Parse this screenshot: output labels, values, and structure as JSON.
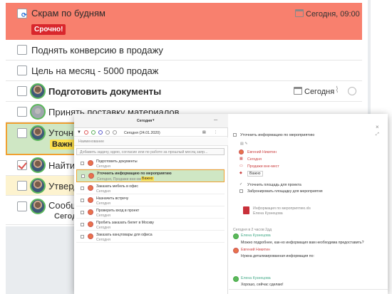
{
  "tasks": [
    {
      "title": "Скрам по будням",
      "badge": "Срочно!",
      "date": "Сегодня, 09:00"
    },
    {
      "title": "Поднять конверсию в продажу"
    },
    {
      "title": "Цель на месяц - 5000 продаж"
    },
    {
      "title": "Подготовить документы",
      "date": "Сегодня"
    },
    {
      "title": "Принять поставку материалов"
    },
    {
      "title": "Уточнить информацию по мероприятию",
      "title_visible": "Уточни",
      "badge": "Важно",
      "badge_visible": "Важн"
    },
    {
      "title_visible": "Найти"
    },
    {
      "title_visible": "Утверд"
    },
    {
      "title_visible": "Сообщ",
      "date_visible": "Сегодн"
    }
  ],
  "window": {
    "left": {
      "period": "Сегодня",
      "date_filter": "Сегодня (24.01.2020)",
      "column_header": "Наименование",
      "search_placeholder": "Добавить задачу, идею, согласие или по работе за прошлый месяц запр...",
      "items": [
        {
          "title": "Подготовить документы",
          "sub": "Сегодня"
        },
        {
          "title": "Уточнить информацию по мероприятию",
          "sub": "Сегодня, Продажи вне-мест",
          "badge": "Важно"
        },
        {
          "title": "Заказать мебель в офис",
          "sub": "Сегодня"
        },
        {
          "title": "Назначить встречу",
          "sub": "Сегодня"
        },
        {
          "title": "Проверить вход в проект",
          "sub": "Сегодня"
        },
        {
          "title": "Пробить заказать билет в Москву",
          "sub": "Сегодня"
        },
        {
          "title": "Заказать канцтовары для офиса",
          "sub": "Сегодня"
        }
      ]
    },
    "right": {
      "task_title": "Уточнить информацию по мероприятию",
      "fields": [
        "Евгений Никитин",
        "Сегодня",
        "Продажи вне-мест",
        "Важно"
      ],
      "subtasks": [
        "Уточнить площадь для проекта",
        "Забронировать площадку для мероприятия"
      ],
      "attachment": "Информация по мероприятию.xls",
      "attachment_sub": "Елена Кузнецова",
      "comments_header": "Сегодня в 2 часов 2дд",
      "comments": [
        {
          "author": "Елена Кузнецова",
          "text": "Можно подробнее, как-но информация вам необходима предоставить?"
        },
        {
          "author": "Евгений Никитин",
          "text": "Нужна детализированная информация по:"
        },
        {
          "author": "Елена Кузнецова",
          "text": "Хорошо, сейчас сделаю!"
        }
      ],
      "close": "×"
    }
  },
  "colors": {
    "urgent_row": "#f8806e",
    "urgent_badge": "#d9262c",
    "important_badge": "#ffe14d",
    "selected_row": "#cfe7c4",
    "avatar_ring": "#5cb85c"
  }
}
